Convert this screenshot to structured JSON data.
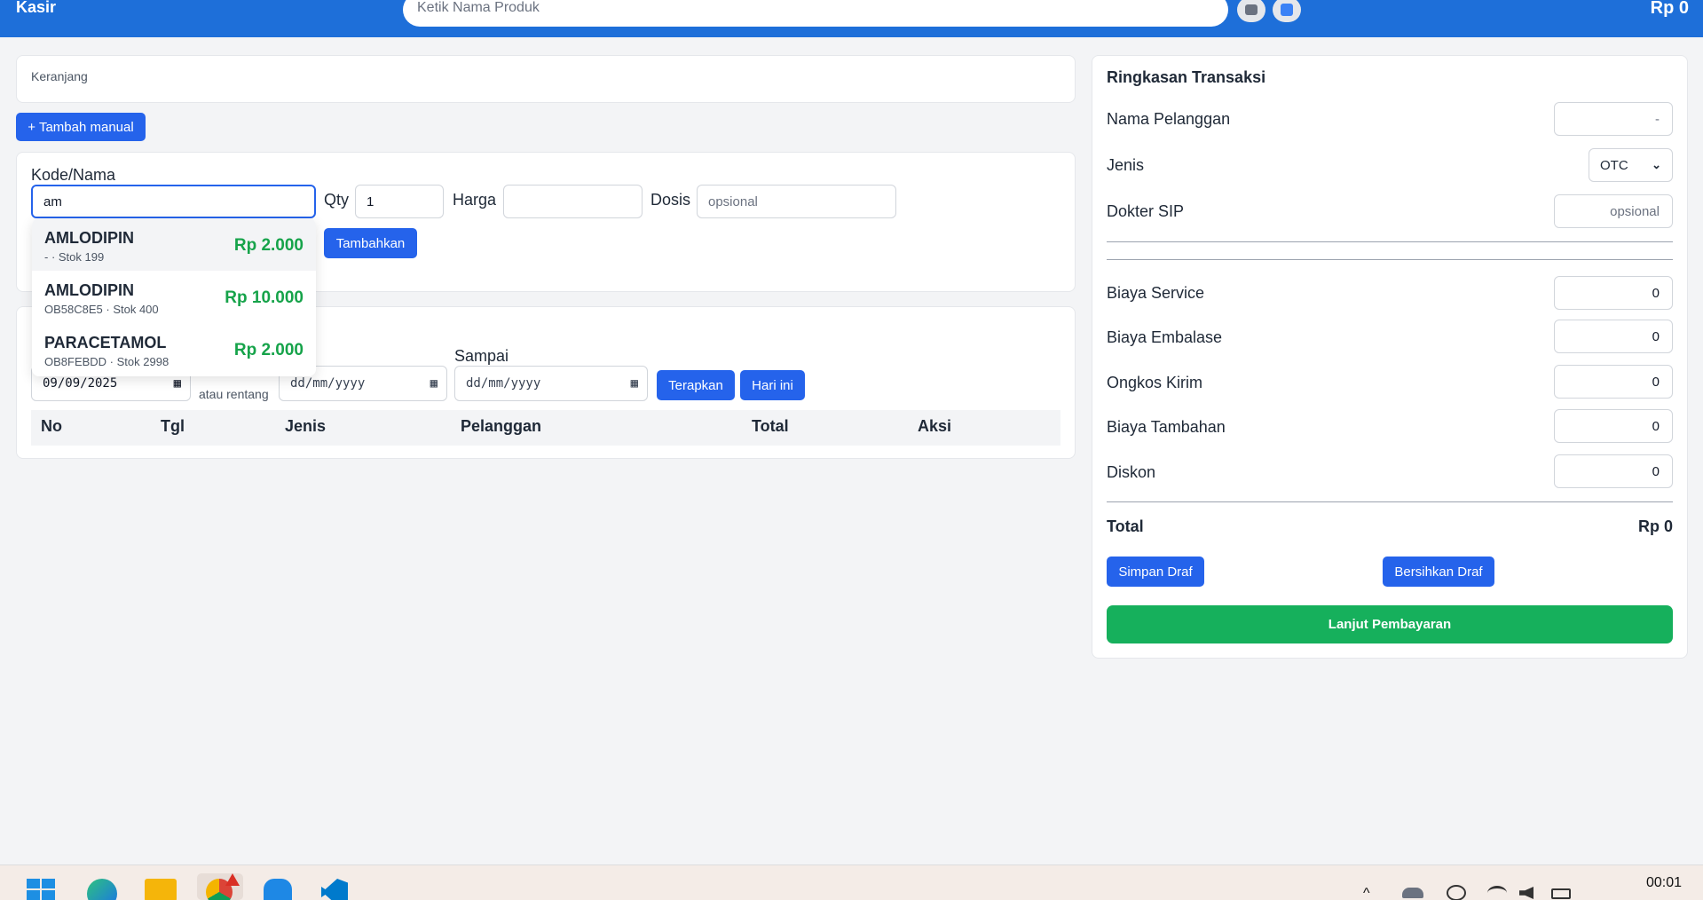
{
  "topbar": {
    "title": "Kasir",
    "search_placeholder": "Ketik Nama Produk",
    "total": "Rp 0"
  },
  "cart": {
    "title": "Keranjang",
    "add_manual": "+ Tambah manual"
  },
  "form": {
    "kode_label": "Kode/Nama",
    "kode_value": "am",
    "qty_label": "Qty",
    "qty_value": "1",
    "harga_label": "Harga",
    "harga_value": "",
    "dosis_label": "Dosis",
    "dosis_placeholder": "opsional",
    "add_button": "Tambahkan"
  },
  "suggestions": [
    {
      "name": "AMLODIPIN",
      "sub": "- · Stok 199",
      "price": "Rp 2.000"
    },
    {
      "name": "AMLODIPIN",
      "sub": "OB58C8E5 · Stok 400",
      "price": "Rp 10.000"
    },
    {
      "name": "PARACETAMOL",
      "sub": "OB8FEBDD · Stok 2998",
      "price": "Rp 2.000"
    }
  ],
  "history": {
    "date_value": "09/09/2025",
    "or_range": "atau rentang",
    "sampai_label": "Sampai",
    "from_placeholder": "dd/mm/yyyy",
    "to_placeholder": "dd/mm/yyyy",
    "apply": "Terapkan",
    "today": "Hari ini",
    "columns": [
      "No",
      "Tgl",
      "Jenis",
      "Pelanggan",
      "Total",
      "Aksi"
    ]
  },
  "summary": {
    "title": "Ringkasan Transaksi",
    "customer_label": "Nama Pelanggan",
    "customer_placeholder": "-",
    "type_label": "Jenis",
    "type_value": "OTC",
    "doctor_label": "Dokter SIP",
    "doctor_placeholder": "opsional",
    "fees": [
      {
        "label": "Biaya Service",
        "value": "0"
      },
      {
        "label": "Biaya Embalase",
        "value": "0"
      },
      {
        "label": "Ongkos Kirim",
        "value": "0"
      },
      {
        "label": "Biaya Tambahan",
        "value": "0"
      },
      {
        "label": "Diskon",
        "value": "0"
      }
    ],
    "total_label": "Total",
    "total_value": "Rp 0",
    "save_draft": "Simpan Draf",
    "clear_draft": "Bersihkan Draf",
    "proceed": "Lanjut Pembayaran"
  },
  "taskbar": {
    "time": "00:01"
  },
  "colors": {
    "primary": "#2563eb",
    "success": "#16a34a",
    "topbar": "#1e6fd9"
  }
}
